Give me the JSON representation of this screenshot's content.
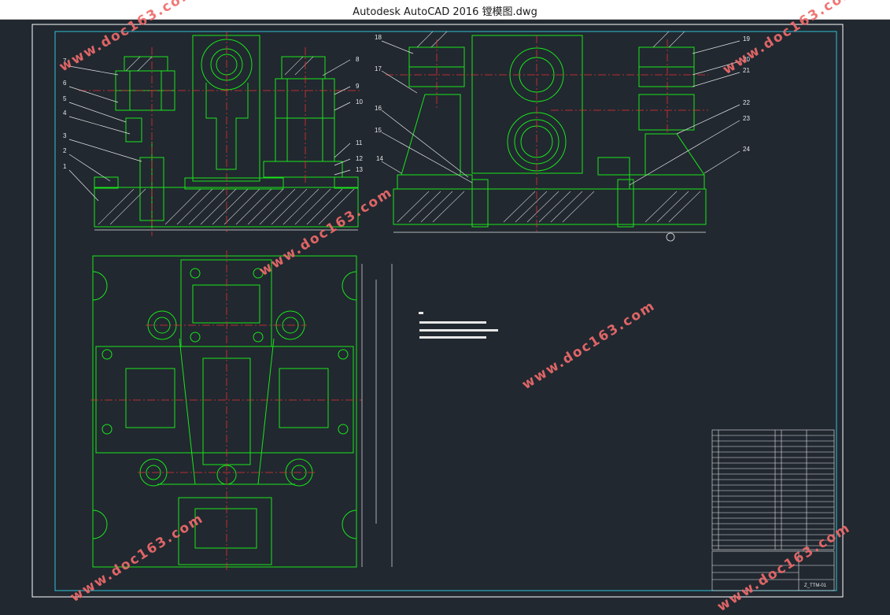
{
  "window": {
    "title": "Autodesk AutoCAD 2016     镗模图.dwg"
  },
  "watermark": {
    "text": "www.doc163.com"
  },
  "colors": {
    "background": "#212830",
    "geometry": "#19e619",
    "frame": "#ffffff",
    "border_inner": "#2ec4d6",
    "centerline": "#e83030",
    "annotation": "#e6e6e6",
    "hatch": "#cfcfcf",
    "watermark": "#f06b6b"
  },
  "drawing": {
    "part_numbers": [
      "1",
      "2",
      "3",
      "4",
      "5",
      "6",
      "7",
      "8",
      "9",
      "10",
      "11",
      "12",
      "13",
      "14",
      "15",
      "16",
      "17",
      "18",
      "19",
      "20",
      "21",
      "22",
      "23",
      "24"
    ]
  },
  "title_block": {
    "drawing_number": "Z_TTM-01"
  }
}
